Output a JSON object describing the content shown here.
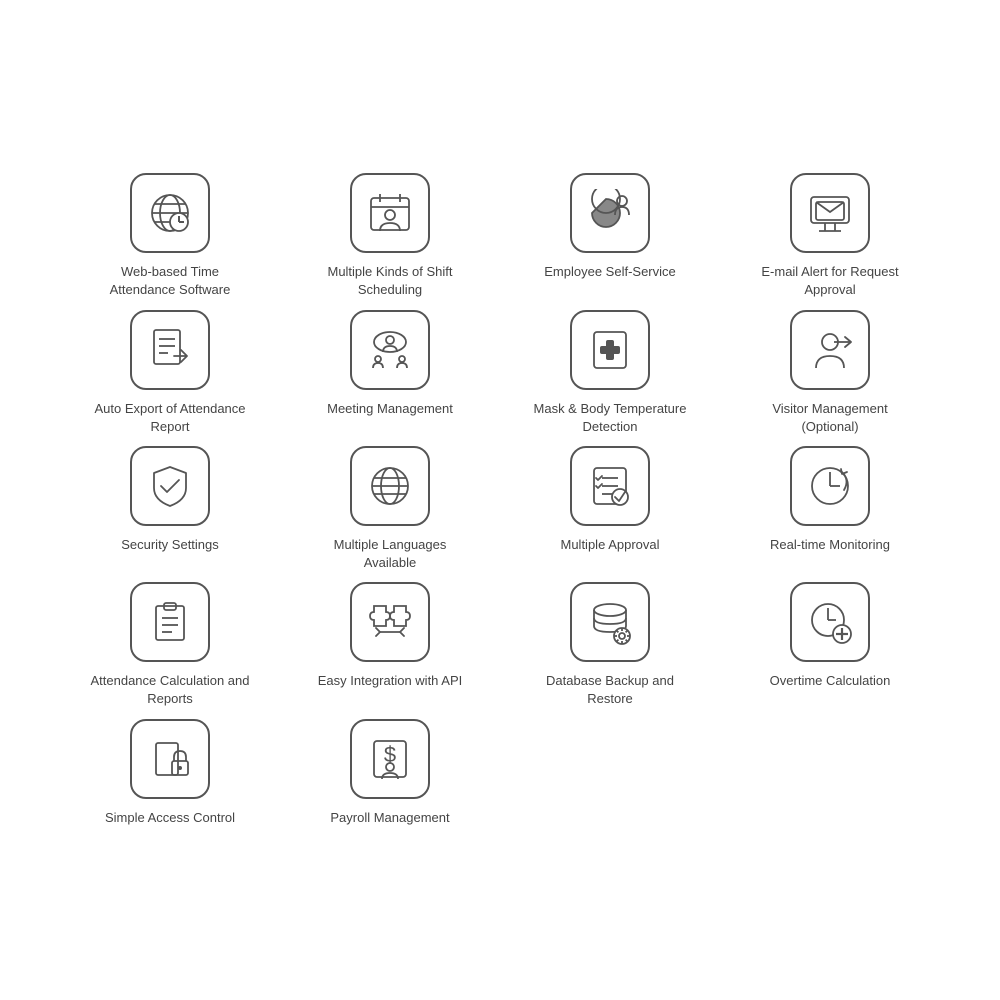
{
  "features": [
    {
      "id": "web-time-attendance",
      "label": "Web-based Time Attendance Software",
      "icon": "globe-clock"
    },
    {
      "id": "shift-scheduling",
      "label": "Multiple Kinds of Shift Scheduling",
      "icon": "calendar-person"
    },
    {
      "id": "employee-self-service",
      "label": "Employee Self-Service",
      "icon": "person-pie"
    },
    {
      "id": "email-alert",
      "label": "E-mail Alert for Request Approval",
      "icon": "email-screen"
    },
    {
      "id": "auto-export",
      "label": "Auto Export of Attendance Report",
      "icon": "doc-export"
    },
    {
      "id": "meeting-management",
      "label": "Meeting Management",
      "icon": "person-cloud"
    },
    {
      "id": "mask-body-temp",
      "label": "Mask & Body Temperature Detection",
      "icon": "medical-cross"
    },
    {
      "id": "visitor-management",
      "label": "Visitor Management (Optional)",
      "icon": "person-arrow"
    },
    {
      "id": "security-settings",
      "label": "Security Settings",
      "icon": "shield-check"
    },
    {
      "id": "multi-language",
      "label": "Multiple Languages Available",
      "icon": "globe-network"
    },
    {
      "id": "multiple-approval",
      "label": "Multiple Approval",
      "icon": "checklist"
    },
    {
      "id": "realtime-monitoring",
      "label": "Real-time Monitoring",
      "icon": "clock-arrow"
    },
    {
      "id": "attendance-calc",
      "label": "Attendance Calculation and Reports",
      "icon": "clipboard"
    },
    {
      "id": "easy-integration",
      "label": "Easy Integration with API",
      "icon": "puzzle-arrows"
    },
    {
      "id": "database-backup",
      "label": "Database Backup and Restore",
      "icon": "database-gear"
    },
    {
      "id": "overtime-calc",
      "label": "Overtime Calculation",
      "icon": "clock-plus"
    },
    {
      "id": "simple-access",
      "label": "Simple Access Control",
      "icon": "lock-card"
    },
    {
      "id": "payroll-management",
      "label": "Payroll Management",
      "icon": "dollar-person"
    }
  ]
}
